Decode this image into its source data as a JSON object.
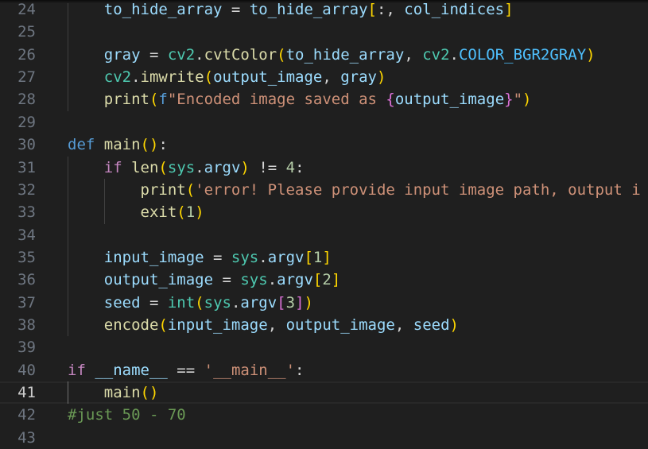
{
  "editor": {
    "language": "python",
    "current_line": 41,
    "lines": [
      {
        "n": "24",
        "indent": 1,
        "tokens": [
          [
            "to_hide_array",
            "var"
          ],
          [
            " = ",
            "op"
          ],
          [
            "to_hide_array",
            "var"
          ],
          [
            "[",
            "b0"
          ],
          [
            ":, ",
            "op"
          ],
          [
            "col_indices",
            "var"
          ],
          [
            "]",
            "b0"
          ]
        ]
      },
      {
        "n": "25",
        "indent": 1,
        "tokens": []
      },
      {
        "n": "26",
        "indent": 1,
        "tokens": [
          [
            "gray",
            "var"
          ],
          [
            " = ",
            "op"
          ],
          [
            "cv2",
            "cls"
          ],
          [
            ".",
            "op"
          ],
          [
            "cvtColor",
            "fn"
          ],
          [
            "(",
            "b0"
          ],
          [
            "to_hide_array",
            "var"
          ],
          [
            ", ",
            "op"
          ],
          [
            "cv2",
            "cls"
          ],
          [
            ".",
            "op"
          ],
          [
            "COLOR_BGR2GRAY",
            "const"
          ],
          [
            ")",
            "b0"
          ]
        ]
      },
      {
        "n": "27",
        "indent": 1,
        "tokens": [
          [
            "cv2",
            "cls"
          ],
          [
            ".",
            "op"
          ],
          [
            "imwrite",
            "fn"
          ],
          [
            "(",
            "b0"
          ],
          [
            "output_image",
            "var"
          ],
          [
            ", ",
            "op"
          ],
          [
            "gray",
            "var"
          ],
          [
            ")",
            "b0"
          ]
        ]
      },
      {
        "n": "28",
        "indent": 1,
        "tokens": [
          [
            "print",
            "fn"
          ],
          [
            "(",
            "b0"
          ],
          [
            "f",
            "kw"
          ],
          [
            "\"Encoded image saved as ",
            "str"
          ],
          [
            "{",
            "b1"
          ],
          [
            "output_image",
            "var"
          ],
          [
            "}",
            "b1"
          ],
          [
            "\"",
            "str"
          ],
          [
            ")",
            "b0"
          ]
        ]
      },
      {
        "n": "29",
        "indent": 0,
        "tokens": []
      },
      {
        "n": "30",
        "indent": 0,
        "tokens": [
          [
            "def",
            "kw"
          ],
          [
            " ",
            "op"
          ],
          [
            "main",
            "fn"
          ],
          [
            "(",
            "b0"
          ],
          [
            ")",
            "b0"
          ],
          [
            ":",
            "op"
          ]
        ]
      },
      {
        "n": "31",
        "indent": 1,
        "tokens": [
          [
            "if",
            "ctl"
          ],
          [
            " ",
            "op"
          ],
          [
            "len",
            "fn"
          ],
          [
            "(",
            "b0"
          ],
          [
            "sys",
            "cls"
          ],
          [
            ".",
            "op"
          ],
          [
            "argv",
            "var"
          ],
          [
            ")",
            "b0"
          ],
          [
            " != ",
            "op"
          ],
          [
            "4",
            "num"
          ],
          [
            ":",
            "op"
          ]
        ]
      },
      {
        "n": "32",
        "indent": 2,
        "tokens": [
          [
            "print",
            "fn"
          ],
          [
            "(",
            "b0"
          ],
          [
            "'error! Please provide input image path, output i",
            "str"
          ]
        ]
      },
      {
        "n": "33",
        "indent": 2,
        "tokens": [
          [
            "exit",
            "fn"
          ],
          [
            "(",
            "b0"
          ],
          [
            "1",
            "num"
          ],
          [
            ")",
            "b0"
          ]
        ]
      },
      {
        "n": "34",
        "indent": 1,
        "tokens": []
      },
      {
        "n": "35",
        "indent": 1,
        "tokens": [
          [
            "input_image",
            "var"
          ],
          [
            " = ",
            "op"
          ],
          [
            "sys",
            "cls"
          ],
          [
            ".",
            "op"
          ],
          [
            "argv",
            "var"
          ],
          [
            "[",
            "b0"
          ],
          [
            "1",
            "num"
          ],
          [
            "]",
            "b0"
          ]
        ]
      },
      {
        "n": "36",
        "indent": 1,
        "tokens": [
          [
            "output_image",
            "var"
          ],
          [
            " = ",
            "op"
          ],
          [
            "sys",
            "cls"
          ],
          [
            ".",
            "op"
          ],
          [
            "argv",
            "var"
          ],
          [
            "[",
            "b0"
          ],
          [
            "2",
            "num"
          ],
          [
            "]",
            "b0"
          ]
        ]
      },
      {
        "n": "37",
        "indent": 1,
        "tokens": [
          [
            "seed",
            "var"
          ],
          [
            " = ",
            "op"
          ],
          [
            "int",
            "cls"
          ],
          [
            "(",
            "b0"
          ],
          [
            "sys",
            "cls"
          ],
          [
            ".",
            "op"
          ],
          [
            "argv",
            "var"
          ],
          [
            "[",
            "b1"
          ],
          [
            "3",
            "num"
          ],
          [
            "]",
            "b1"
          ],
          [
            ")",
            "b0"
          ]
        ]
      },
      {
        "n": "38",
        "indent": 1,
        "tokens": [
          [
            "encode",
            "fn"
          ],
          [
            "(",
            "b0"
          ],
          [
            "input_image",
            "var"
          ],
          [
            ", ",
            "op"
          ],
          [
            "output_image",
            "var"
          ],
          [
            ", ",
            "op"
          ],
          [
            "seed",
            "var"
          ],
          [
            ")",
            "b0"
          ]
        ]
      },
      {
        "n": "39",
        "indent": 0,
        "tokens": []
      },
      {
        "n": "40",
        "indent": 0,
        "tokens": [
          [
            "if",
            "ctl"
          ],
          [
            " ",
            "op"
          ],
          [
            "__name__",
            "var"
          ],
          [
            " == ",
            "op"
          ],
          [
            "'__main__'",
            "str"
          ],
          [
            ":",
            "op"
          ]
        ]
      },
      {
        "n": "41",
        "indent": 1,
        "tokens": [
          [
            "main",
            "fn"
          ],
          [
            "(",
            "b0"
          ],
          [
            ")",
            "b0"
          ]
        ]
      },
      {
        "n": "42",
        "indent": 0,
        "tokens": [
          [
            "#just 50 - 70",
            "cmt"
          ]
        ]
      },
      {
        "n": "43",
        "indent": 0,
        "tokens": []
      }
    ]
  }
}
